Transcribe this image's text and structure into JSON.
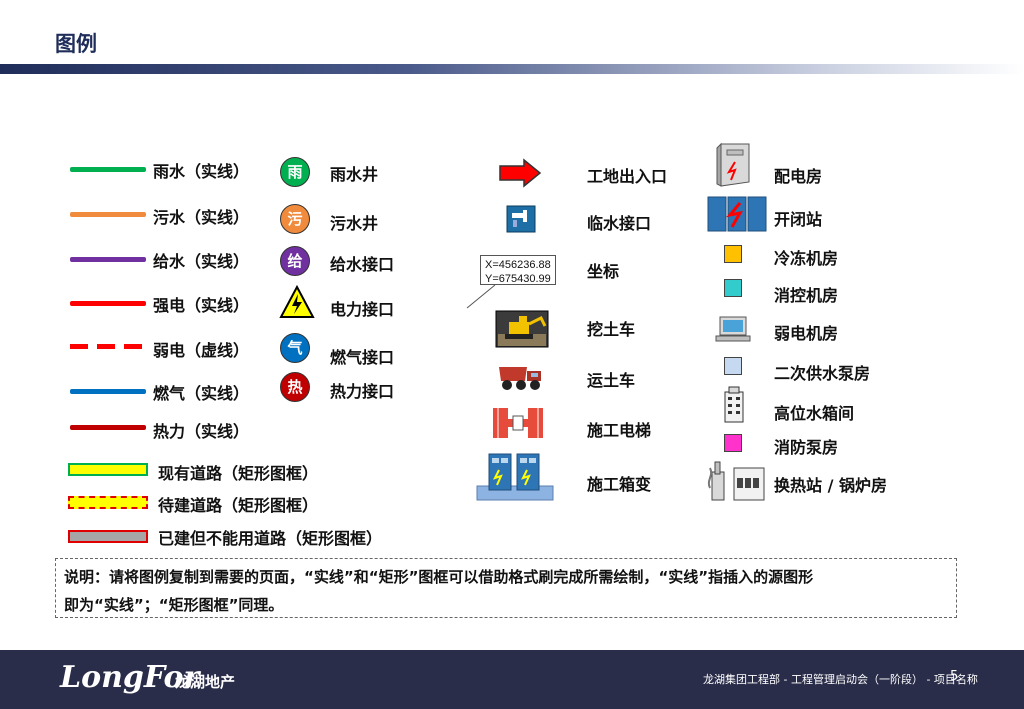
{
  "page": {
    "title": "图例"
  },
  "lines": [
    {
      "label": "雨水（实线）",
      "color": "#00b050",
      "style": "solid"
    },
    {
      "label": "污水（实线）",
      "color": "#f08a3c",
      "style": "solid"
    },
    {
      "label": "给水（实线）",
      "color": "#7030a0",
      "style": "solid"
    },
    {
      "label": "强电（实线）",
      "color": "#ff0000",
      "style": "solid"
    },
    {
      "label": "弱电（虚线）",
      "color": "#ff0000",
      "style": "dashed"
    },
    {
      "label": "燃气（实线）",
      "color": "#0070c0",
      "style": "solid"
    },
    {
      "label": "热力（实线）",
      "color": "#c00000",
      "style": "solid"
    }
  ],
  "roads": [
    {
      "label": "现有道路（矩形图框）",
      "fill": "#ffff00",
      "style": "solid"
    },
    {
      "label": "待建道路（矩形图框）",
      "fill": "#ffff00",
      "style": "dashed"
    },
    {
      "label": "已建但不能用道路（矩形图框）",
      "fill": "#a6a6a6",
      "style": "solid"
    }
  ],
  "symbols": [
    {
      "glyph": "雨",
      "label": "雨水井",
      "color": "#00b050"
    },
    {
      "glyph": "污",
      "label": "污水井",
      "color": "#f08a3c"
    },
    {
      "glyph": "给",
      "label": "给水接口",
      "color": "#7030a0"
    },
    {
      "glyph": "⚡",
      "label": "电力接口",
      "color": "#ffff00"
    },
    {
      "glyph": "气",
      "label": "燃气接口",
      "color": "#0070c0"
    },
    {
      "glyph": "热",
      "label": "热力接口",
      "color": "#c00000"
    }
  ],
  "site": [
    {
      "label": "工地出入口",
      "icon": "arrow-icon"
    },
    {
      "label": "临水接口",
      "icon": "faucet-icon"
    },
    {
      "label": "坐标",
      "icon": "callout-icon"
    },
    {
      "label": "挖土车",
      "icon": "excavator-icon"
    },
    {
      "label": "运土车",
      "icon": "dump-truck-icon"
    },
    {
      "label": "施工电梯",
      "icon": "elevator-icon"
    },
    {
      "label": "施工箱变",
      "icon": "transformer-icon"
    }
  ],
  "coord": {
    "x": "X=456236.88",
    "y": "Y=675430.99"
  },
  "rooms": [
    {
      "label": "配电房",
      "icon": "cabinet-icon"
    },
    {
      "label": "开闭站",
      "icon": "switchgear-icon"
    },
    {
      "label": "冷冻机房",
      "color": "#ffc000"
    },
    {
      "label": "消控机房",
      "color": "#33cccc"
    },
    {
      "label": "弱电机房",
      "icon": "computer-icon"
    },
    {
      "label": "二次供水泵房",
      "color": "#c5d9f1"
    },
    {
      "label": "高位水箱间",
      "icon": "building-icon"
    },
    {
      "label": "消防泵房",
      "color": "#ff33cc"
    },
    {
      "label": "换热站 / 锅炉房",
      "icon": "boiler-icon"
    }
  ],
  "note": {
    "line1": "说明：请将图例复制到需要的页面，“实线”和“矩形”图框可以借助格式刷完成所需绘制，“实线”指插入的源图形",
    "line2": "即为“实线”；“矩形图框”同理。"
  },
  "footer": {
    "logo": "LongFor",
    "logo_cn": "龙湖地产",
    "text": "龙湖集团工程部 - 工程管理启动会（一阶段） - 项目名称",
    "page": "5"
  }
}
